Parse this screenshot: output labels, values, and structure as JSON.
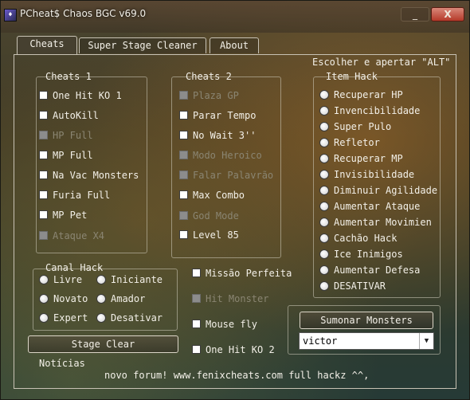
{
  "window": {
    "title": "PCheat$ Chaos BGC v69.0",
    "minimize_label": "_",
    "close_label": "X"
  },
  "tabs": [
    {
      "label": "Cheats",
      "active": true
    },
    {
      "label": "Super Stage Cleaner",
      "active": false
    },
    {
      "label": "About",
      "active": false
    }
  ],
  "cheats1": {
    "title": "Cheats 1",
    "items": [
      {
        "label": "One Hit KO 1",
        "enabled": true
      },
      {
        "label": "AutoKill",
        "enabled": true
      },
      {
        "label": "HP Full",
        "enabled": false
      },
      {
        "label": "MP Full",
        "enabled": true
      },
      {
        "label": "Na Vac Monsters",
        "enabled": true
      },
      {
        "label": "Furia Full",
        "enabled": true
      },
      {
        "label": "MP Pet",
        "enabled": true
      },
      {
        "label": "Ataque X4",
        "enabled": false
      }
    ]
  },
  "cheats2": {
    "title": "Cheats 2",
    "items": [
      {
        "label": "Plaza GP",
        "enabled": false
      },
      {
        "label": "Parar Tempo",
        "enabled": true
      },
      {
        "label": "No Wait 3''",
        "enabled": true
      },
      {
        "label": "Modo Heroico",
        "enabled": false
      },
      {
        "label": "Falar Palavrão",
        "enabled": false
      },
      {
        "label": "Max Combo",
        "enabled": true
      },
      {
        "label": "God Mode",
        "enabled": false
      },
      {
        "label": "Level 85",
        "enabled": true
      }
    ]
  },
  "item_hack": {
    "hint": "Escolher e apertar \"ALT\"",
    "title": "Item Hack",
    "items": [
      "Recuperar HP",
      "Invencibilidade",
      "Super Pulo",
      "Refletor",
      "Recuperar MP",
      "Invisibilidade",
      "Diminuir Agilidade",
      "Aumentar Ataque",
      "Aumentar Movimien",
      "Cachão Hack",
      "Ice Inimigos",
      "Aumentar Defesa",
      "DESATIVAR"
    ]
  },
  "canal_hack": {
    "title": "Canal Hack",
    "options": [
      "Livre",
      "Iniciante",
      "Novato",
      "Amador",
      "Expert",
      "Desativar"
    ]
  },
  "extras": [
    {
      "label": "Missão Perfeita",
      "enabled": true
    },
    {
      "label": "Hit Monster",
      "enabled": false
    },
    {
      "label": "Mouse fly",
      "enabled": true
    },
    {
      "label": "One Hit KO 2",
      "enabled": true
    }
  ],
  "buttons": {
    "stage_clear": "Stage Clear",
    "summon": "Sumonar Monsters"
  },
  "summon_select": {
    "value": "victor"
  },
  "news": {
    "label": "Notícias",
    "text": "novo forum! www.fenixcheats.com  full hackz ^^,"
  }
}
